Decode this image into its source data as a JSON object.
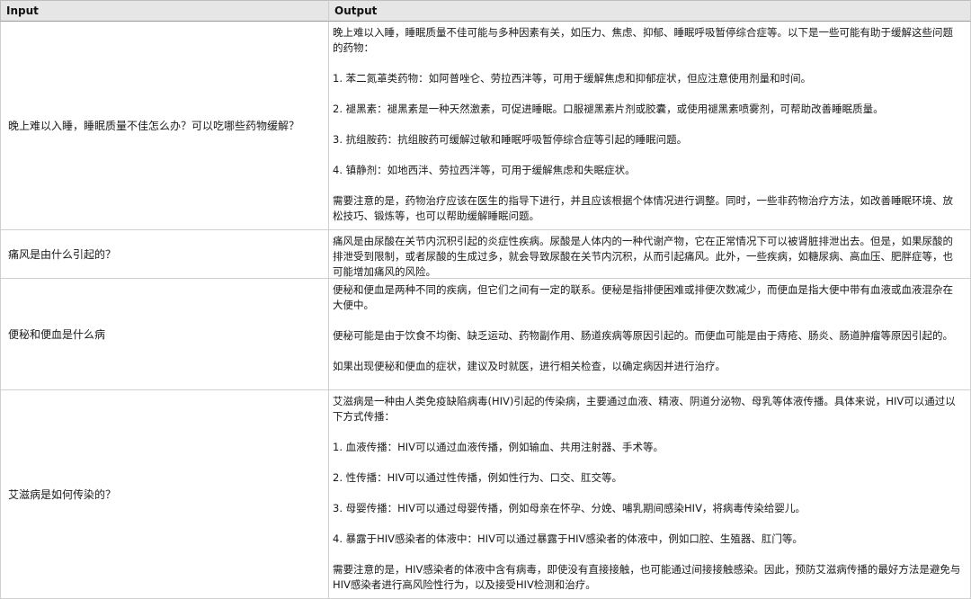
{
  "table": {
    "headers": [
      "Input",
      "Output"
    ],
    "rows": [
      {
        "input": "晚上难以入睡，睡眠质量不佳怎么办？可以吃哪些药物缓解？",
        "output": [
          "晚上难以入睡，睡眠质量不佳可能与多种因素有关，如压力、焦虑、抑郁、睡眠呼吸暂停综合症等。以下是一些可能有助于缓解这些问题的药物：",
          "1. 苯二氮䓬类药物：如阿普唑仑、劳拉西泮等，可用于缓解焦虑和抑郁症状，但应注意使用剂量和时间。",
          "2. 褪黑素：褪黑素是一种天然激素，可促进睡眠。口服褪黑素片剂或胶囊，或使用褪黑素喷雾剂，可帮助改善睡眠质量。",
          "3. 抗组胺药：抗组胺药可缓解过敏和睡眠呼吸暂停综合症等引起的睡眠问题。",
          "4. 镇静剂：如地西泮、劳拉西泮等，可用于缓解焦虑和失眠症状。",
          "需要注意的是，药物治疗应该在医生的指导下进行，并且应该根据个体情况进行调整。同时，一些非药物治疗方法，如改善睡眠环境、放松技巧、锻炼等，也可以帮助缓解睡眠问题。"
        ]
      },
      {
        "input": "痛风是由什么引起的？",
        "output": [
          "痛风是由尿酸在关节内沉积引起的炎症性疾病。尿酸是人体内的一种代谢产物，它在正常情况下可以被肾脏排泄出去。但是，如果尿酸的排泄受到限制，或者尿酸的生成过多，就会导致尿酸在关节内沉积，从而引起痛风。此外，一些疾病，如糖尿病、高血压、肥胖症等，也可能增加痛风的风险。"
        ]
      },
      {
        "input": "便秘和便血是什么病",
        "output": [
          "便秘和便血是两种不同的疾病，但它们之间有一定的联系。便秘是指排便困难或排便次数减少，而便血是指大便中带有血液或血液混杂在大便中。",
          "便秘可能是由于饮食不均衡、缺乏运动、药物副作用、肠道疾病等原因引起的。而便血可能是由于痔疮、肠炎、肠道肿瘤等原因引起的。",
          "如果出现便秘和便血的症状，建议及时就医，进行相关检查，以确定病因并进行治疗。"
        ]
      },
      {
        "input": "艾滋病是如何传染的？",
        "output": [
          "艾滋病是一种由人类免疫缺陷病毒(HIV)引起的传染病，主要通过血液、精液、阴道分泌物、母乳等体液传播。具体来说，HIV可以通过以下方式传播：",
          "1. 血液传播：HIV可以通过血液传播，例如输血、共用注射器、手术等。",
          "2. 性传播：HIV可以通过性传播，例如性行为、口交、肛交等。",
          "3. 母婴传播：HIV可以通过母婴传播，例如母亲在怀孕、分娩、哺乳期间感染HIV，将病毒传染给婴儿。",
          "4. 暴露于HIV感染者的体液中：HIV可以通过暴露于HIV感染者的体液中，例如口腔、生殖器、肛门等。",
          "需要注意的是，HIV感染者的体液中含有病毒，即使没有直接接触，也可能通过间接接触感染。因此，预防艾滋病传播的最好方法是避免与HIV感染者进行高风险性行为，以及接受HIV检测和治疗。"
        ]
      }
    ]
  }
}
